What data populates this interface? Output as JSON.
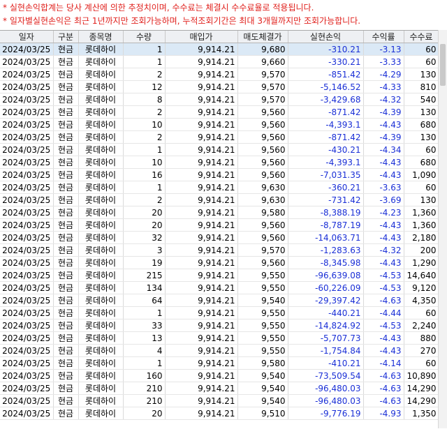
{
  "notices": [
    "* 실현손익합계는 당사 계산에 의한 추정치이며, 수수료는 체결시 수수료율로 적용됩니다.",
    "* 일자별실현손익은 최근 1년까지만 조회가능하며, 누적조회기간은 최대 3개월까지만 조회가능합니다."
  ],
  "columns": [
    "일자",
    "구분",
    "종목명",
    "수량",
    "매입가",
    "매도체결가",
    "실현손익",
    "수익률",
    "수수료"
  ],
  "rows": [
    [
      "2024/03/25",
      "현금",
      "롯데하이",
      "1",
      "9,914.21",
      "9,680",
      "-310.21",
      "-3.13",
      "60"
    ],
    [
      "2024/03/25",
      "현금",
      "롯데하이",
      "1",
      "9,914.21",
      "9,660",
      "-330.21",
      "-3.33",
      "60"
    ],
    [
      "2024/03/25",
      "현금",
      "롯데하이",
      "2",
      "9,914.21",
      "9,570",
      "-851.42",
      "-4.29",
      "130"
    ],
    [
      "2024/03/25",
      "현금",
      "롯데하이",
      "12",
      "9,914.21",
      "9,570",
      "-5,146.52",
      "-4.33",
      "810"
    ],
    [
      "2024/03/25",
      "현금",
      "롯데하이",
      "8",
      "9,914.21",
      "9,570",
      "-3,429.68",
      "-4.32",
      "540"
    ],
    [
      "2024/03/25",
      "현금",
      "롯데하이",
      "2",
      "9,914.21",
      "9,560",
      "-871.42",
      "-4.39",
      "130"
    ],
    [
      "2024/03/25",
      "현금",
      "롯데하이",
      "10",
      "9,914.21",
      "9,560",
      "-4,393.1",
      "-4.43",
      "680"
    ],
    [
      "2024/03/25",
      "현금",
      "롯데하이",
      "2",
      "9,914.21",
      "9,560",
      "-871.42",
      "-4.39",
      "130"
    ],
    [
      "2024/03/25",
      "현금",
      "롯데하이",
      "1",
      "9,914.21",
      "9,560",
      "-430.21",
      "-4.34",
      "60"
    ],
    [
      "2024/03/25",
      "현금",
      "롯데하이",
      "10",
      "9,914.21",
      "9,560",
      "-4,393.1",
      "-4.43",
      "680"
    ],
    [
      "2024/03/25",
      "현금",
      "롯데하이",
      "16",
      "9,914.21",
      "9,560",
      "-7,031.35",
      "-4.43",
      "1,090"
    ],
    [
      "2024/03/25",
      "현금",
      "롯데하이",
      "1",
      "9,914.21",
      "9,630",
      "-360.21",
      "-3.63",
      "60"
    ],
    [
      "2024/03/25",
      "현금",
      "롯데하이",
      "2",
      "9,914.21",
      "9,630",
      "-731.42",
      "-3.69",
      "130"
    ],
    [
      "2024/03/25",
      "현금",
      "롯데하이",
      "20",
      "9,914.21",
      "9,580",
      "-8,388.19",
      "-4.23",
      "1,360"
    ],
    [
      "2024/03/25",
      "현금",
      "롯데하이",
      "20",
      "9,914.21",
      "9,560",
      "-8,787.19",
      "-4.43",
      "1,360"
    ],
    [
      "2024/03/25",
      "현금",
      "롯데하이",
      "32",
      "9,914.21",
      "9,560",
      "-14,063.71",
      "-4.43",
      "2,180"
    ],
    [
      "2024/03/25",
      "현금",
      "롯데하이",
      "3",
      "9,914.21",
      "9,570",
      "-1,283.63",
      "-4.32",
      "200"
    ],
    [
      "2024/03/25",
      "현금",
      "롯데하이",
      "19",
      "9,914.21",
      "9,560",
      "-8,345.98",
      "-4.43",
      "1,290"
    ],
    [
      "2024/03/25",
      "현금",
      "롯데하이",
      "215",
      "9,914.21",
      "9,550",
      "-96,639.08",
      "-4.53",
      "14,640"
    ],
    [
      "2024/03/25",
      "현금",
      "롯데하이",
      "134",
      "9,914.21",
      "9,550",
      "-60,226.09",
      "-4.53",
      "9,120"
    ],
    [
      "2024/03/25",
      "현금",
      "롯데하이",
      "64",
      "9,914.21",
      "9,540",
      "-29,397.42",
      "-4.63",
      "4,350"
    ],
    [
      "2024/03/25",
      "현금",
      "롯데하이",
      "1",
      "9,914.21",
      "9,550",
      "-440.21",
      "-4.44",
      "60"
    ],
    [
      "2024/03/25",
      "현금",
      "롯데하이",
      "33",
      "9,914.21",
      "9,550",
      "-14,824.92",
      "-4.53",
      "2,240"
    ],
    [
      "2024/03/25",
      "현금",
      "롯데하이",
      "13",
      "9,914.21",
      "9,550",
      "-5,707.73",
      "-4.43",
      "880"
    ],
    [
      "2024/03/25",
      "현금",
      "롯데하이",
      "4",
      "9,914.21",
      "9,550",
      "-1,754.84",
      "-4.43",
      "270"
    ],
    [
      "2024/03/25",
      "현금",
      "롯데하이",
      "1",
      "9,914.21",
      "9,580",
      "-410.21",
      "-4.14",
      "60"
    ],
    [
      "2024/03/25",
      "현금",
      "롯데하이",
      "160",
      "9,914.21",
      "9,540",
      "-73,509.54",
      "-4.63",
      "10,890"
    ],
    [
      "2024/03/25",
      "현금",
      "롯데하이",
      "210",
      "9,914.21",
      "9,540",
      "-96,480.03",
      "-4.63",
      "14,290"
    ],
    [
      "2024/03/25",
      "현금",
      "롯데하이",
      "210",
      "9,914.21",
      "9,540",
      "-96,480.03",
      "-4.63",
      "14,290"
    ],
    [
      "2024/03/25",
      "현금",
      "롯데하이",
      "20",
      "9,914.21",
      "9,510",
      "-9,776.19",
      "-4.93",
      "1,350"
    ]
  ],
  "colors": {
    "notice": "#e0201c",
    "loss": "#1a2fd6",
    "selected_row": "#dbe9f6",
    "header_bg": "#eef0f3"
  }
}
